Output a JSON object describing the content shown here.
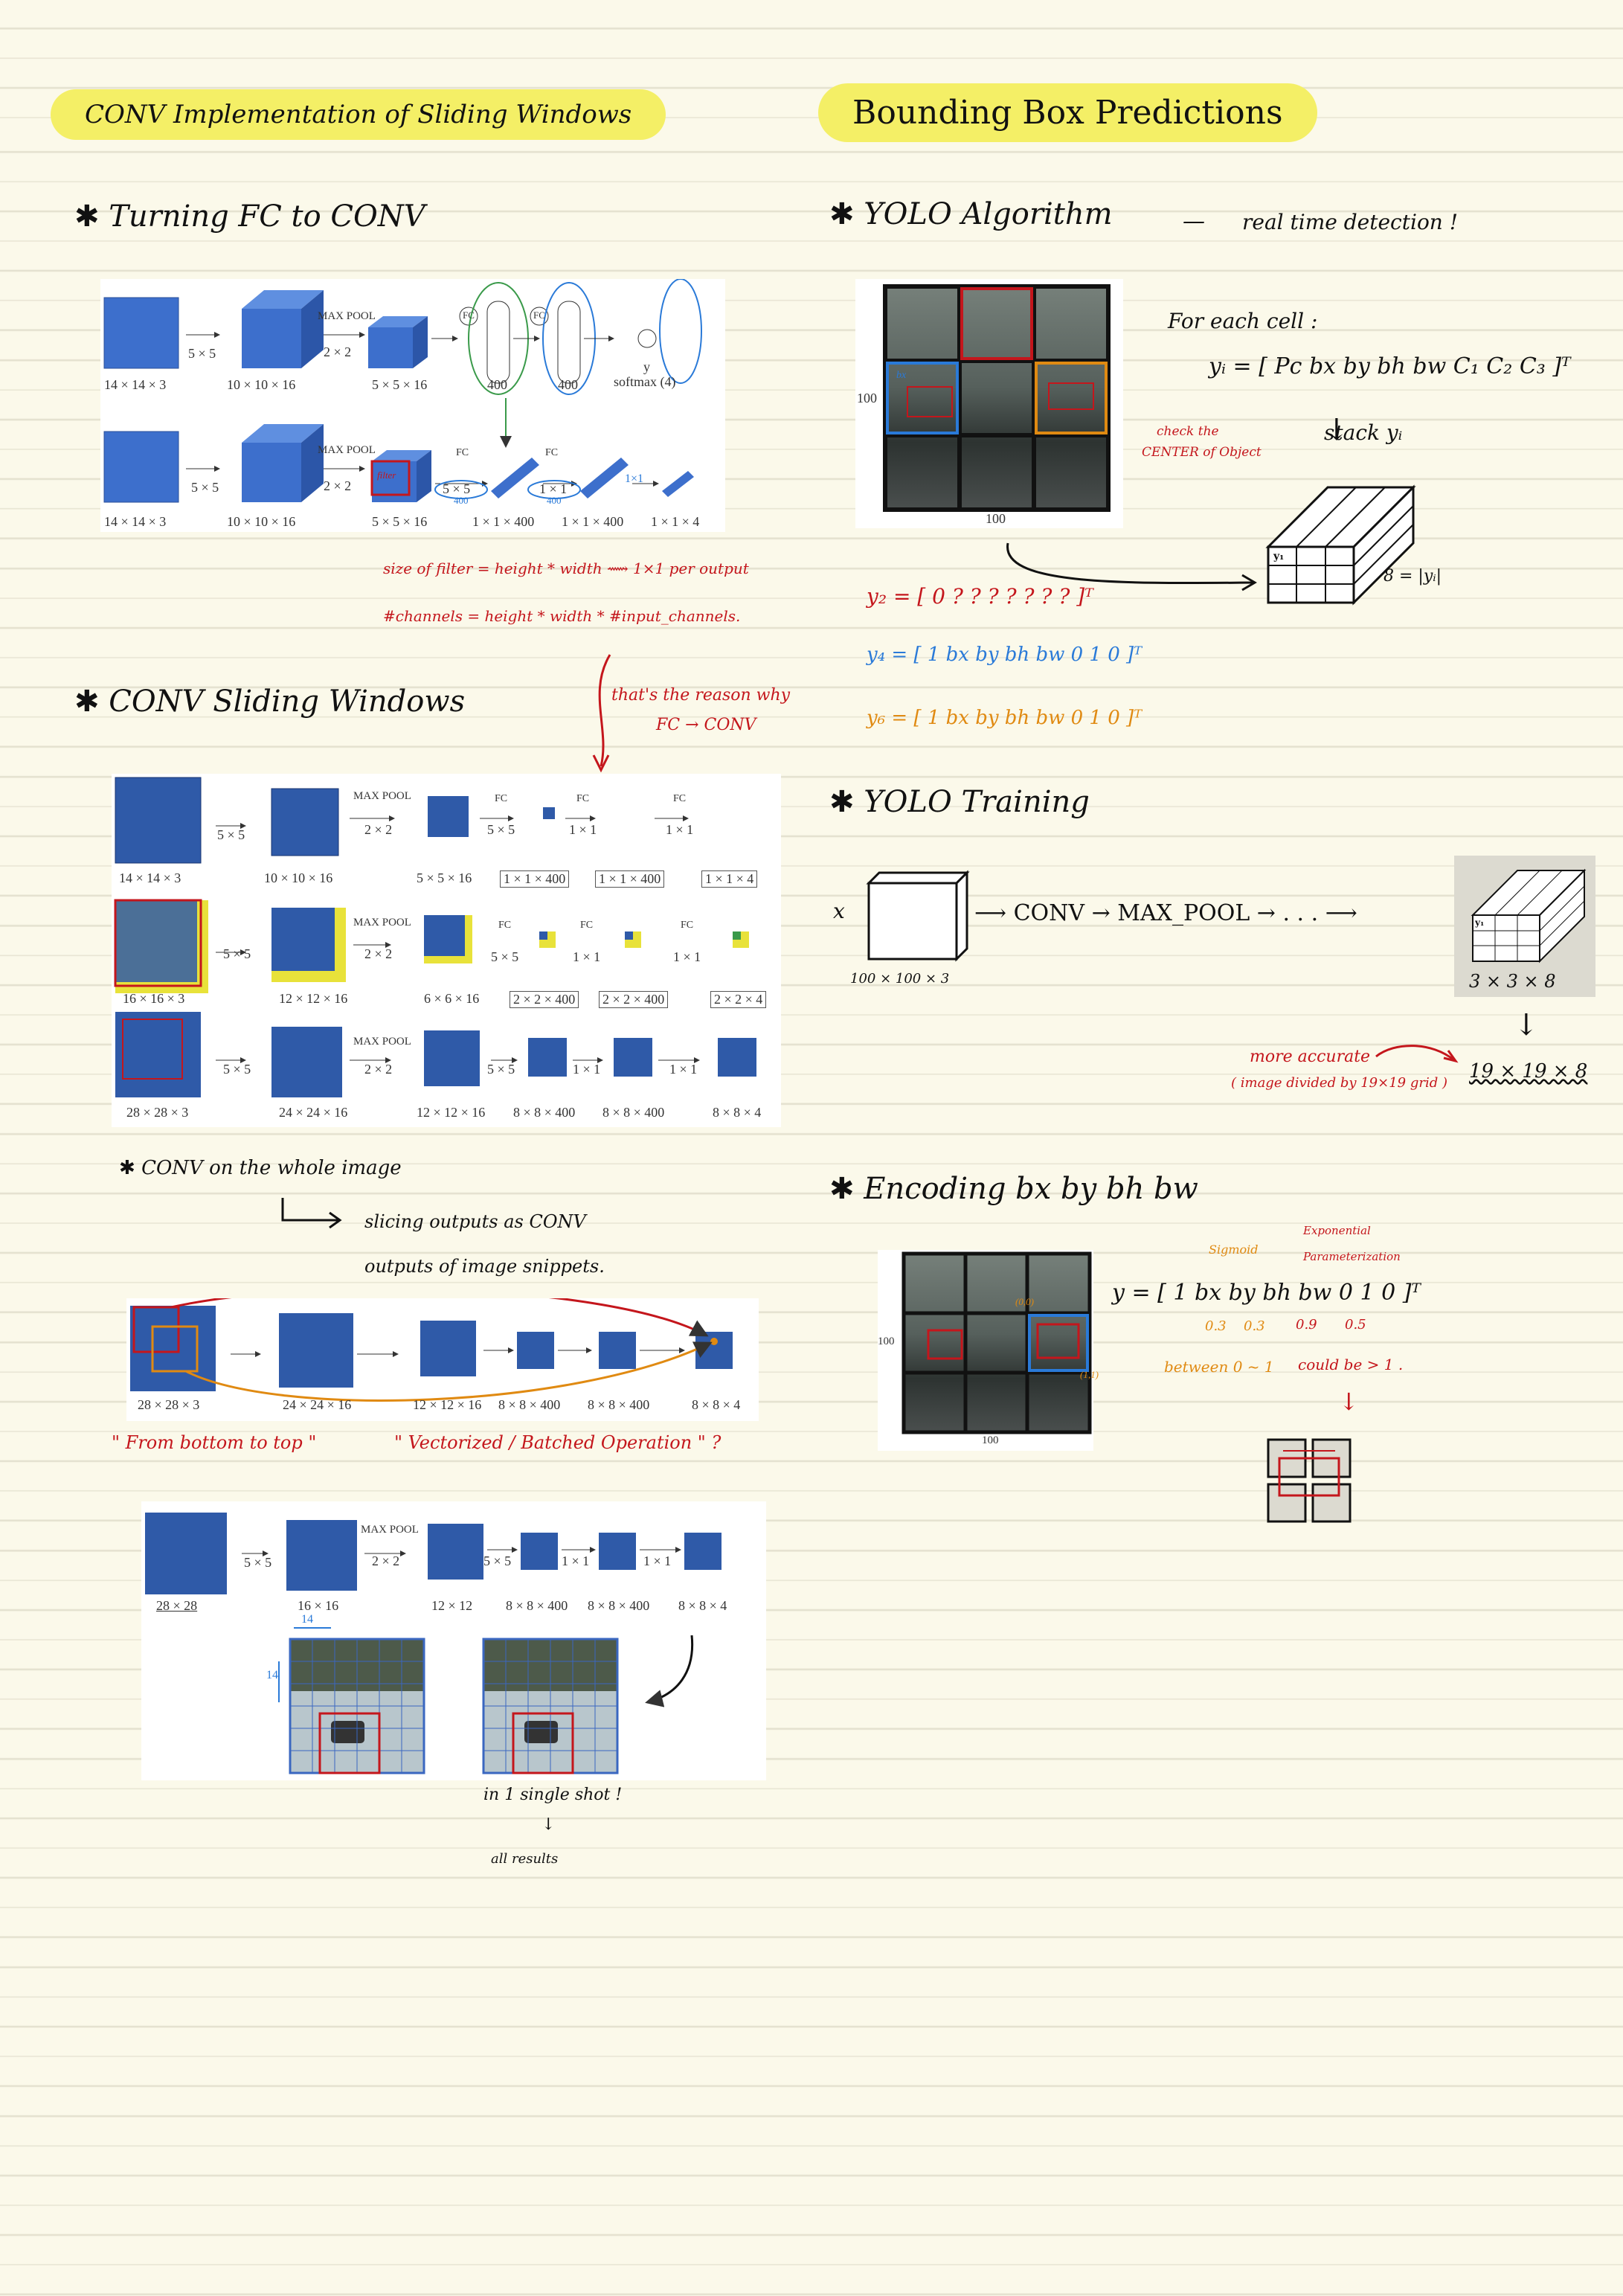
{
  "left": {
    "title": "CONV Implementation of Sliding Windows",
    "s1": {
      "heading": "Turning FC to CONV",
      "fig": {
        "dims_top": [
          "14 × 14 × 3",
          "10 × 10 × 16",
          "5 × 5 × 16"
        ],
        "dims_bottom": [
          "14 × 14 × 3",
          "10 × 10 × 16",
          "5 × 5 × 16",
          "1 × 1 × 400",
          "1 × 1 × 400",
          "1 × 1 × 4"
        ],
        "k5": "5 × 5",
        "maxpool": "MAX POOL",
        "k2": "2 × 2",
        "fc": "FC",
        "n400": "400",
        "y": "y",
        "softmax": "softmax (4)",
        "filter": "filter",
        "k1": "1 × 1",
        "k1b": "1×1"
      },
      "note1": "size of filter = height * width ⟿ 1×1 per output",
      "note2": "#channels = height * width * #input_channels."
    },
    "s2": {
      "heading": "CONV Sliding Windows",
      "reason": "that's the reason why",
      "reason2": "FC → CONV",
      "fig": {
        "r1": [
          "14 × 14 × 3",
          "10 × 10 × 16",
          "5 × 5 × 16",
          "1 × 1 × 400",
          "1 × 1 × 400",
          "1 × 1 × 4"
        ],
        "r2": [
          "16 × 16 × 3",
          "12 × 12 × 16",
          "6 × 6 × 16",
          "2 × 2 × 400",
          "2 × 2 × 400",
          "2 × 2 × 4"
        ],
        "r3": [
          "28 × 28 × 3",
          "24 × 24 × 16",
          "12 × 12 × 16",
          "8 × 8 × 400",
          "8 × 8 × 400",
          "8 × 8 × 4"
        ],
        "k5": "5 × 5",
        "maxpool": "MAX POOL",
        "k2": "2 × 2",
        "fc": "FC",
        "k1": "1 × 1"
      }
    },
    "s3": {
      "heading": "CONV on the whole image",
      "line1": "slicing outputs as CONV",
      "line2": "outputs of image snippets.",
      "fig": [
        "28 × 28 × 3",
        "24 × 24 × 16",
        "12 × 12 × 16",
        "8 × 8 × 400",
        "8 × 8 × 400",
        "8 × 8 × 4"
      ],
      "note_a": "\" From bottom to top \"",
      "note_b": "\" Vectorized / Batched Operation \" ?"
    },
    "s4": {
      "fig": [
        "28 × 28",
        "16 × 16",
        "12 × 12",
        "8 × 8 × 400",
        "8 × 8 × 400",
        "8 × 8 × 4"
      ],
      "n14": "14",
      "shot": "in 1 single shot !",
      "all": "all results"
    }
  },
  "right": {
    "title": "Bounding Box Predictions",
    "s1": {
      "heading": "YOLO Algorithm",
      "dash": "—",
      "rt": "real time detection !",
      "n100": "100",
      "bx": "bx",
      "each": "For each cell :",
      "vec": "yᵢ = [ Pc bx by bh bw C₁ C₂ C₃ ]ᵀ",
      "check": "check the",
      "center": "CENTER of Object",
      "stack": "stack yᵢ",
      "eight": "8 = |yᵢ|",
      "y1": "y₁",
      "y2": "y₂ = [ 0 ? ? ? ? ? ? ? ]ᵀ",
      "y4": "y₄ = [ 1 bx by bh bw 0 1 0 ]ᵀ",
      "y6": "y₆ = [ 1 bx by bh bw 0 1 0 ]ᵀ"
    },
    "s2": {
      "heading": "YOLO Training",
      "x": "x",
      "pipe": "CONV → MAX_POOL → . . .",
      "dims": "100 × 100 × 3",
      "y1": "y₁",
      "out": "3 × 3 × 8",
      "acc": "more accurate",
      "paren": "( image divided by 19×19 grid )",
      "big": "19 × 19 × 8"
    },
    "s3": {
      "heading": "Encoding bx by bh bw",
      "n100": "100",
      "c00": "(0,0)",
      "c11": "(1,1)",
      "sig": "Sigmoid",
      "exp1": "Exponential",
      "exp2": "Parameterization",
      "vec": "y = [ 1 bx by bh bw 0 1 0 ]ᵀ",
      "vals": [
        "0.3",
        "0.3",
        "0.9",
        "0.5"
      ],
      "between": "between 0 ~ 1",
      "could": "could be > 1 ."
    }
  }
}
